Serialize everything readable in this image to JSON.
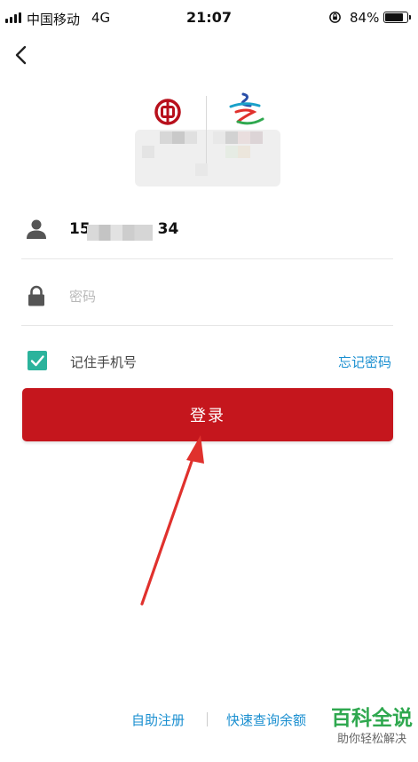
{
  "status_bar": {
    "carrier": "中国移动",
    "network": "4G",
    "time": "21:07",
    "battery_percent": "84%",
    "battery_level": 0.84
  },
  "logos": {
    "bank_logo_icon": "boc-logo",
    "games_logo_icon": "winter-games-logo"
  },
  "form": {
    "phone_prefix": "15",
    "phone_suffix": "34",
    "password_placeholder": "密码",
    "remember_label": "记住手机号",
    "remember_checked": true,
    "forgot_label": "忘记密码",
    "login_label": "登录"
  },
  "footer": {
    "register_label": "自助注册",
    "quick_query_label": "快速查询余额"
  },
  "watermark": {
    "title": "百科全说",
    "subtitle": "助你轻松解决"
  },
  "colors": {
    "brand_red": "#c5161d",
    "link_blue": "#1a8fd0",
    "check_green": "#2bb39c",
    "annotation_red": "#e0312d"
  }
}
